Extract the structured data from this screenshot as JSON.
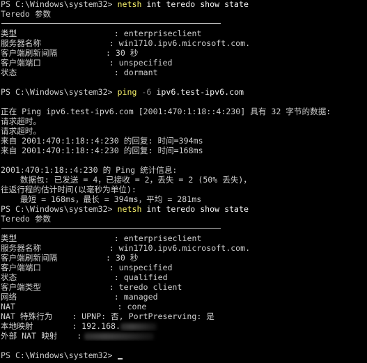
{
  "console": {
    "lines": [
      {
        "kind": "cmd",
        "prompt": "PS C:\\Windows\\system32> ",
        "keyword": "netsh",
        "flag": "",
        "rest": " int teredo show state"
      },
      {
        "kind": "text",
        "text": "Teredo 参数"
      },
      {
        "kind": "sep"
      },
      {
        "kind": "text",
        "text": "类型                    : enterpriseclient"
      },
      {
        "kind": "text",
        "text": "服务器名称              : win1710.ipv6.microsoft.com."
      },
      {
        "kind": "text",
        "text": "客户端刷新间隔          : 30 秒"
      },
      {
        "kind": "text",
        "text": "客户端端口              : unspecified"
      },
      {
        "kind": "text",
        "text": "状态                    : dormant"
      },
      {
        "kind": "blank"
      },
      {
        "kind": "cmd",
        "prompt": "PS C:\\Windows\\system32> ",
        "keyword": "ping",
        "flag": " -6",
        "rest": " ipv6.test-ipv6.com"
      },
      {
        "kind": "blank"
      },
      {
        "kind": "text",
        "text": "正在 Ping ipv6.test-ipv6.com [2001:470:1:18::4:230] 具有 32 字节的数据:"
      },
      {
        "kind": "text",
        "text": "请求超时。"
      },
      {
        "kind": "text",
        "text": "请求超时。"
      },
      {
        "kind": "text",
        "text": "来自 2001:470:1:18::4:230 的回复: 时间=394ms"
      },
      {
        "kind": "text",
        "text": "来自 2001:470:1:18::4:230 的回复: 时间=168ms"
      },
      {
        "kind": "blank"
      },
      {
        "kind": "text",
        "text": "2001:470:1:18::4:230 的 Ping 统计信息:"
      },
      {
        "kind": "text",
        "text": "    数据包: 已发送 = 4，已接收 = 2，丢失 = 2 (50% 丢失)，"
      },
      {
        "kind": "text",
        "text": "往返行程的估计时间(以毫秒为单位):"
      },
      {
        "kind": "text",
        "text": "    最短 = 168ms，最长 = 394ms，平均 = 281ms"
      },
      {
        "kind": "cmd",
        "prompt": "PS C:\\Windows\\system32> ",
        "keyword": "netsh",
        "flag": "",
        "rest": " int teredo show state"
      },
      {
        "kind": "text",
        "text": "Teredo 参数"
      },
      {
        "kind": "sep"
      },
      {
        "kind": "text",
        "text": "类型                    : enterpriseclient"
      },
      {
        "kind": "text",
        "text": "服务器名称              : win1710.ipv6.microsoft.com."
      },
      {
        "kind": "text",
        "text": "客户端刷新间隔          : 30 秒"
      },
      {
        "kind": "text",
        "text": "客户端端口              : unspecified"
      },
      {
        "kind": "text",
        "text": "状态                    : qualified"
      },
      {
        "kind": "text",
        "text": "客户端类型              : teredo client"
      },
      {
        "kind": "text",
        "text": "网络                    : managed"
      },
      {
        "kind": "text",
        "text": "NAT                     : cone"
      },
      {
        "kind": "text",
        "text": "NAT 特殊行为    : UPNP: 否, PortPreserving: 是"
      },
      {
        "kind": "redacted",
        "text": "本地映射        : 192.168.",
        "blur": "ip"
      },
      {
        "kind": "redacted",
        "text": "外部 NAT 映射    :",
        "blur": "ext"
      },
      {
        "kind": "blank"
      },
      {
        "kind": "prompt",
        "prompt": "PS C:\\Windows\\system32>"
      }
    ]
  }
}
